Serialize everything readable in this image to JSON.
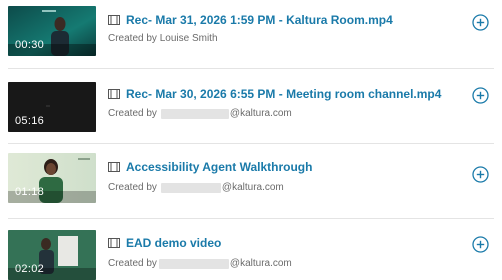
{
  "entries": [
    {
      "duration": "00:30",
      "title": "Rec- Mar 31, 2026 1:59 PM - Kaltura Room.mp4",
      "created_by_label": "Created by",
      "creator": "Louise Smith",
      "creator_email_domain": ""
    },
    {
      "duration": "05:16",
      "title": "Rec- Mar 30, 2026 6:55 PM - Meeting room channel.mp4",
      "created_by_label": "Created by",
      "creator": "",
      "creator_email_domain": "@kaltura.com"
    },
    {
      "duration": "01:18",
      "title": "Accessibility Agent Walkthrough",
      "created_by_label": "Created by",
      "creator": "",
      "creator_email_domain": "@kaltura.com"
    },
    {
      "duration": "02:02",
      "title": "EAD demo video",
      "created_by_label": "Created by",
      "creator": "",
      "creator_email_domain": "@kaltura.com"
    }
  ],
  "colors": {
    "title_link": "#1a7aa9",
    "add_icon": "#1a7aa9",
    "meta_text": "#6b6b6b",
    "separator": "#e4e4e4"
  },
  "icons": {
    "media_type": "film-icon",
    "add": "plus-circle-icon"
  }
}
